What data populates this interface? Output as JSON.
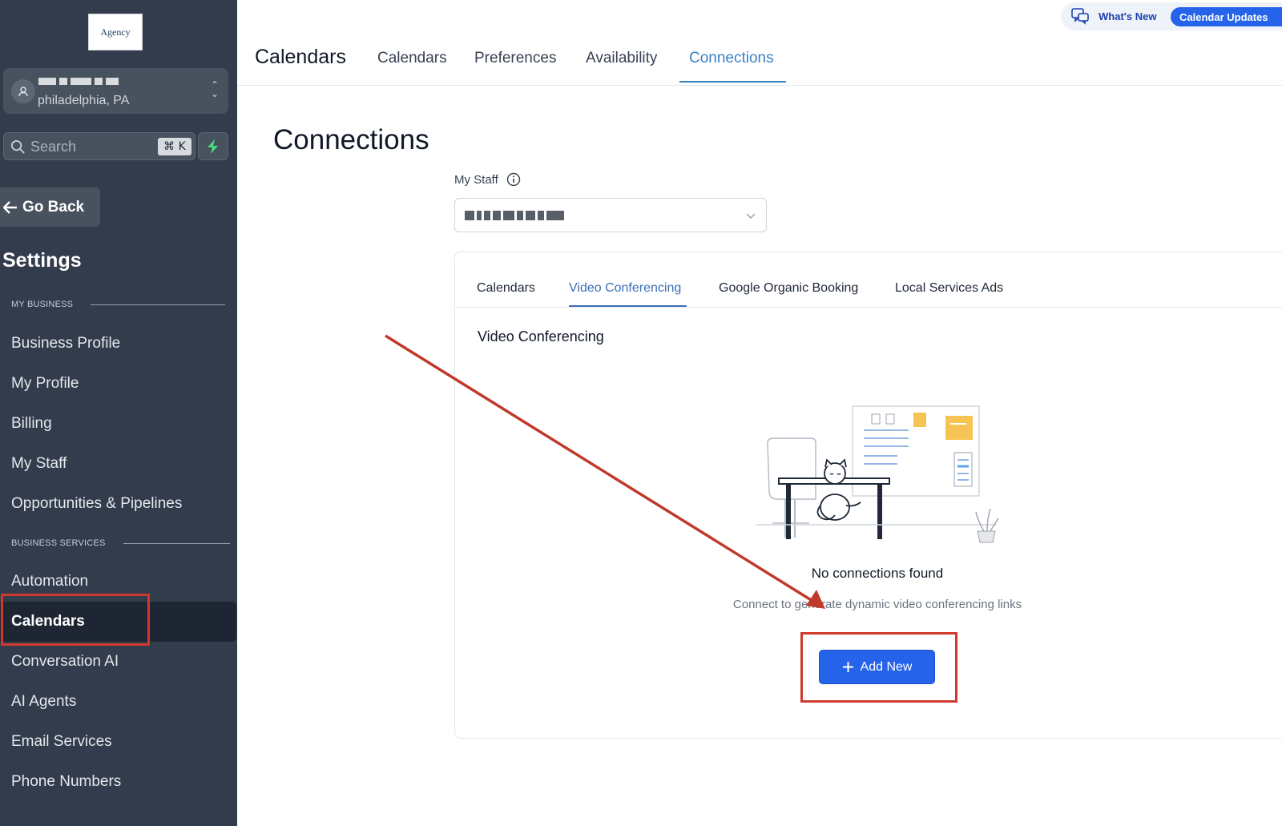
{
  "sidebar": {
    "logo_text": "Agency",
    "account": {
      "location": "philadelphia, PA"
    },
    "search": {
      "placeholder": "Search",
      "shortcut": "⌘ K"
    },
    "go_back": "Go Back",
    "title": "Settings",
    "sections": {
      "my_business": "MY BUSINESS",
      "business_services": "BUSINESS SERVICES"
    },
    "items": {
      "business_profile": "Business Profile",
      "my_profile": "My Profile",
      "billing": "Billing",
      "my_staff": "My Staff",
      "opportunities": "Opportunities & Pipelines",
      "automation": "Automation",
      "calendars": "Calendars",
      "conversation_ai": "Conversation AI",
      "ai_agents": "AI Agents",
      "email_services": "Email Services",
      "phone_numbers": "Phone Numbers"
    },
    "active_item": "Calendars"
  },
  "header": {
    "title": "Calendars",
    "tabs": [
      "Calendars",
      "Preferences",
      "Availability",
      "Connections"
    ],
    "active_tab": "Connections",
    "whats_new": "What's New",
    "update_pill": "Calendar Updates"
  },
  "main": {
    "title": "Connections",
    "staff_label": "My Staff",
    "card": {
      "tabs": [
        "Calendars",
        "Video Conferencing",
        "Google Organic Booking",
        "Local Services Ads"
      ],
      "active_tab": "Video Conferencing",
      "subtitle": "Video Conferencing",
      "empty_title": "No connections found",
      "empty_description": "Connect to generate dynamic video conferencing links",
      "add_button": "Add New"
    }
  },
  "colors": {
    "sidebar_bg": "#323c4d",
    "accent": "#2563eb",
    "tab_active": "#3b82c4",
    "annotation_red": "#d03a2c"
  },
  "icons": [
    "user-icon",
    "chevron-updown-icon",
    "search-icon",
    "bolt-icon",
    "arrow-left-icon",
    "chat-icon",
    "info-icon",
    "chevron-down-icon",
    "plus-icon"
  ]
}
